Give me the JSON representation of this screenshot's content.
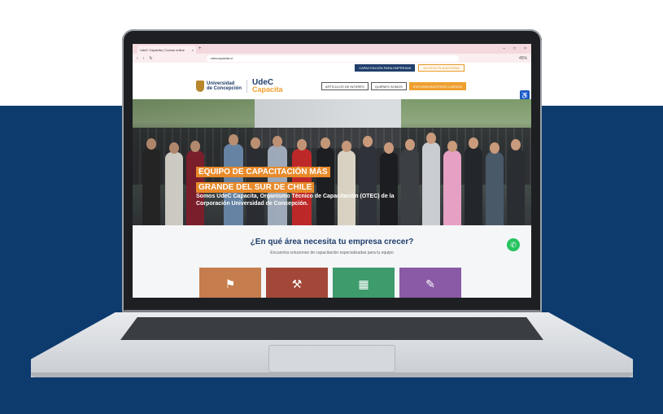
{
  "browser": {
    "tab_title": "UdeC Capacita | Cursos online",
    "tab_close": "×",
    "new_tab": "+",
    "window_controls": [
      "–",
      "□",
      "×"
    ],
    "url": "udeccapacita.cl",
    "nav_back": "‹",
    "nav_forward": "›",
    "reload": "↻",
    "zoom": "45%"
  },
  "site": {
    "top_buttons": {
      "empresas": "CAPACITACIÓN PARA EMPRESAS",
      "plataforma": "ACCESO PLATAFORMA"
    },
    "logo_udec": [
      "Universidad",
      "de Concepción"
    ],
    "logo_capacita": [
      "UdeC",
      "Capacita"
    ],
    "nav": [
      "ARTÍCULOS DE INTERÉS",
      "QUIÉNES SOMOS",
      "EXPLORA NUESTROS CURSOS"
    ],
    "hero": {
      "headline_1": "EQUIPO DE CAPACITACIÓN MÁS",
      "headline_2": "GRANDE DEL SUR DE CHILE",
      "subtitle": "Somos UdeC Capacita, Organismo Técnico de Capacitación (OTEC) de la Corporación Universidad de Concepción."
    },
    "section": {
      "question": "¿En qué área necesita tu empresa crecer?",
      "subtitle": "Encuentra soluciones de capacitación especializadas para tu equipo"
    },
    "icons": {
      "accessibility": "♿",
      "whatsapp": "✆",
      "cards": [
        "⚑",
        "⚒",
        "▦",
        "✎"
      ]
    }
  }
}
